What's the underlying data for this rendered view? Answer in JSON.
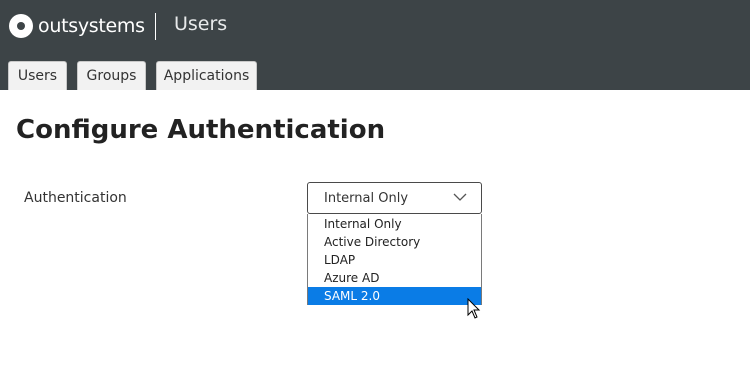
{
  "header": {
    "brand": "outsystems",
    "app_title": "Users",
    "background": "#3d4447"
  },
  "tabs": [
    {
      "label": "Users"
    },
    {
      "label": "Groups"
    },
    {
      "label": "Applications"
    }
  ],
  "main": {
    "title": "Configure Authentication",
    "field_label": "Authentication",
    "select": {
      "value": "Internal Only",
      "options": [
        "Internal Only",
        "Active Directory",
        "LDAP",
        "Azure AD",
        "SAML 2.0"
      ],
      "highlighted": "SAML 2.0",
      "highlight_color": "#0a7ce6"
    }
  },
  "icons": {
    "logo": "outsystems-logo-icon",
    "dropdown": "chevron-down-icon",
    "cursor": "mouse-pointer-icon"
  }
}
